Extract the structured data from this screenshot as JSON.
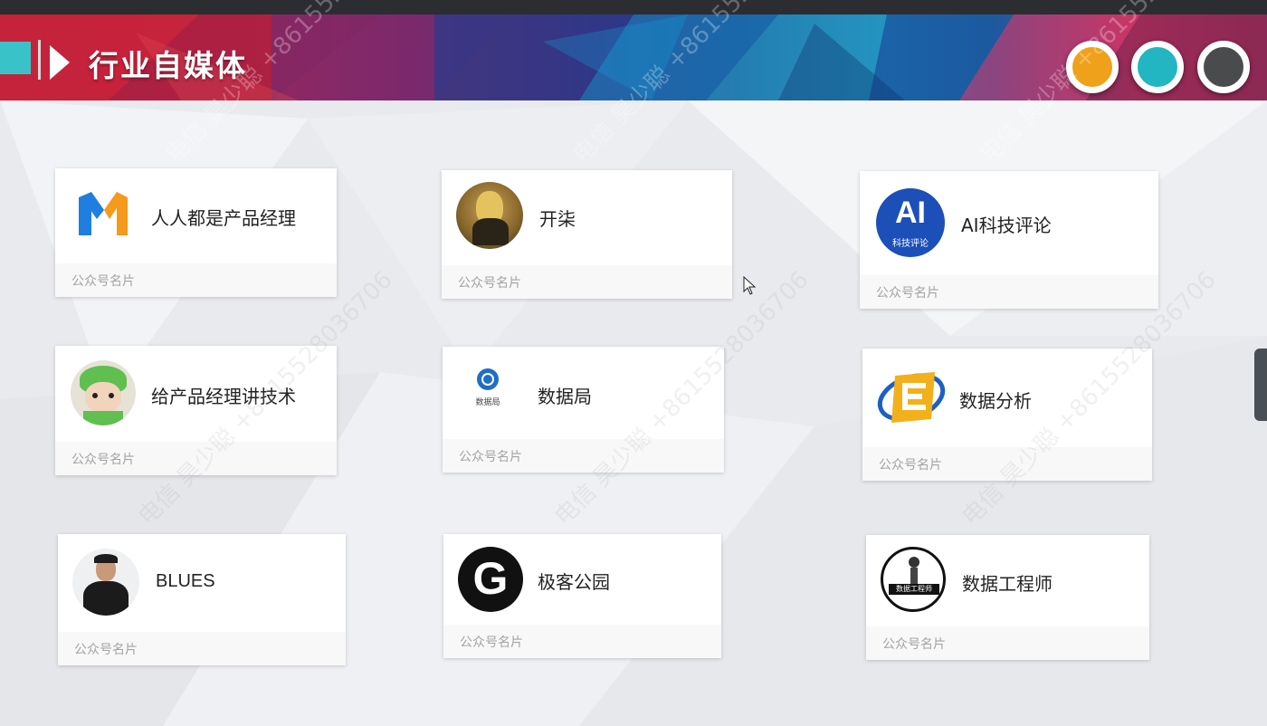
{
  "header": {
    "title": "行业自媒体"
  },
  "dots": [
    {
      "color": "#f0a11a"
    },
    {
      "color": "#22b5c2"
    },
    {
      "color": "#4a4b4d"
    }
  ],
  "cards": [
    {
      "name": "人人都是产品经理",
      "caption": "公众号名片",
      "icon": "pm-logo-icon"
    },
    {
      "name": "开柒",
      "caption": "公众号名片",
      "icon": "mona-lisa-avatar-icon"
    },
    {
      "name": "AI科技评论",
      "caption": "公众号名片",
      "icon": "ai-logo-icon",
      "logo_text": "AI",
      "logo_sub": "科技评论"
    },
    {
      "name": "给产品经理讲技术",
      "caption": "公众号名片",
      "icon": "cartoon-frog-avatar-icon"
    },
    {
      "name": "数据局",
      "caption": "公众号名片",
      "icon": "data-bureau-logo-icon",
      "logo_sub": "数据局"
    },
    {
      "name": "数据分析",
      "caption": "公众号名片",
      "icon": "data-analysis-logo-icon"
    },
    {
      "name": "BLUES",
      "caption": "公众号名片",
      "icon": "person-avatar-icon"
    },
    {
      "name": "极客公园",
      "caption": "公众号名片",
      "icon": "geekpark-logo-icon",
      "logo_text": "G"
    },
    {
      "name": "数据工程师",
      "caption": "公众号名片",
      "icon": "data-engineer-logo-icon",
      "logo_sub": "数据工程师"
    }
  ],
  "watermark": {
    "text": "电信 昊少聪 +8615528036706"
  }
}
